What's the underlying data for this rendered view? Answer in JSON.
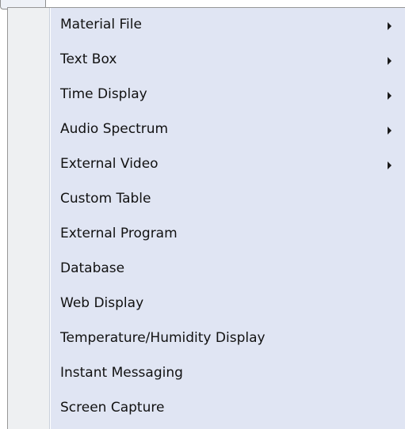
{
  "menu": {
    "items": [
      {
        "label": "Material File",
        "has_submenu": true
      },
      {
        "label": "Text Box",
        "has_submenu": true
      },
      {
        "label": "Time Display",
        "has_submenu": true
      },
      {
        "label": "Audio Spectrum",
        "has_submenu": true
      },
      {
        "label": "External Video",
        "has_submenu": true
      },
      {
        "label": "Custom Table",
        "has_submenu": false
      },
      {
        "label": "External Program",
        "has_submenu": false
      },
      {
        "label": "Database",
        "has_submenu": false
      },
      {
        "label": "Web Display",
        "has_submenu": false
      },
      {
        "label": "Temperature/Humidity Display",
        "has_submenu": false
      },
      {
        "label": "Instant Messaging",
        "has_submenu": false
      },
      {
        "label": "Screen Capture",
        "has_submenu": false
      }
    ]
  },
  "colors": {
    "menu_background": "#e0e5f3",
    "gutter_background": "#eef0f2",
    "border": "#979797",
    "text": "#111111"
  }
}
